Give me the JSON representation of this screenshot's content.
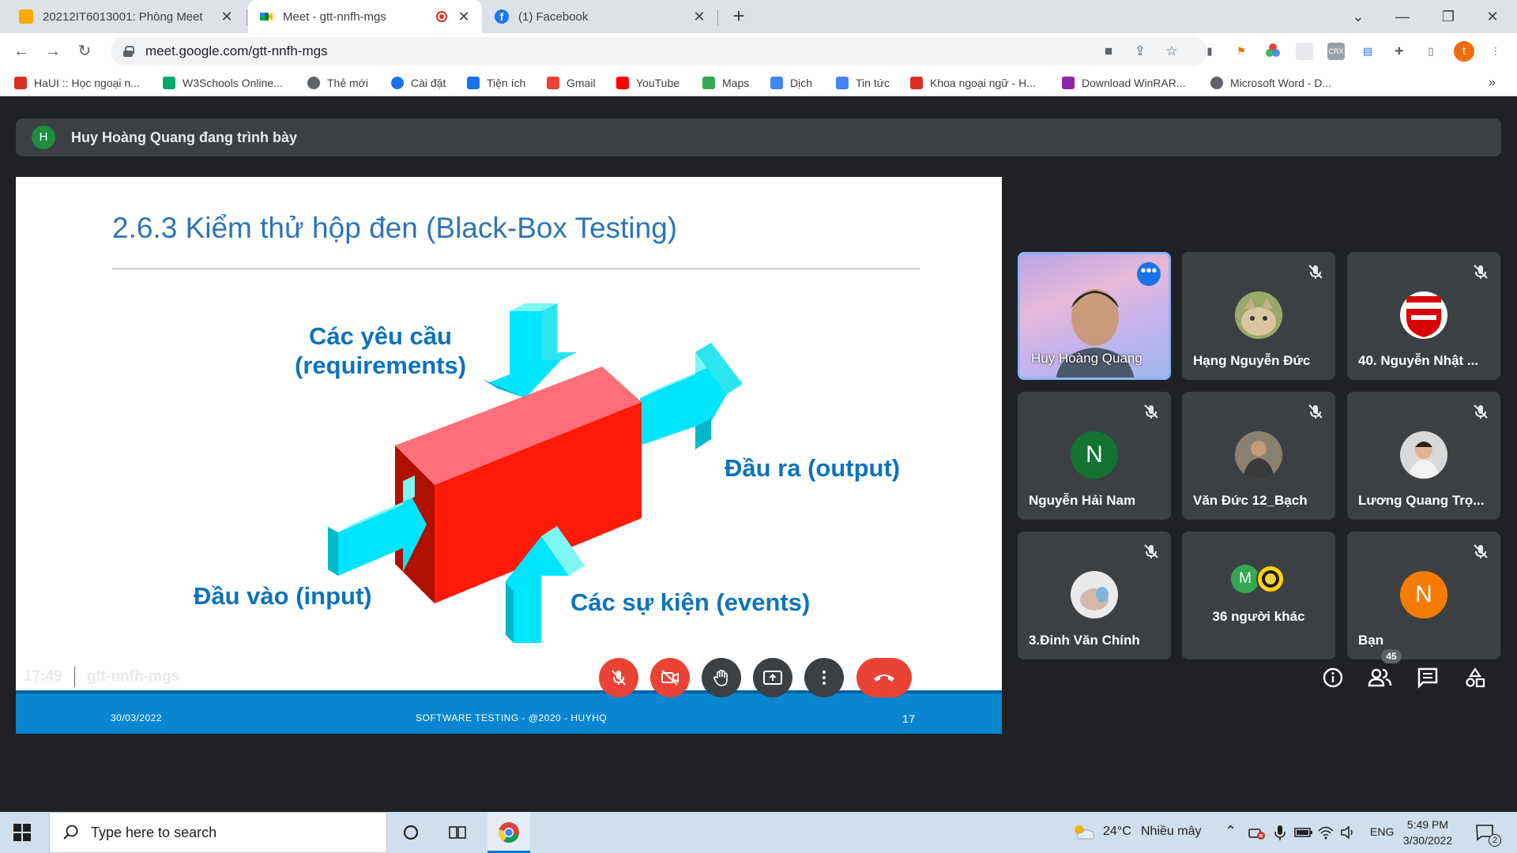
{
  "browser": {
    "tabs": [
      {
        "title": "20212IT6013001: Phòng Meet",
        "icon": "haui-favicon"
      },
      {
        "title": "Meet - gtt-nnfh-mgs",
        "icon": "meet-favicon"
      },
      {
        "title": "(1) Facebook",
        "icon": "facebook-favicon"
      }
    ],
    "new_tab_label": "+",
    "url": "meet.google.com/gtt-nnfh-mgs",
    "profile_initial": "t",
    "bookmarks": [
      {
        "label": "HaUI :: Học ngoại n...",
        "color": "#d93025"
      },
      {
        "label": "W3Schools Online...",
        "color": "#04aa6d"
      },
      {
        "label": "Thẻ mới",
        "color": "#5f6368"
      },
      {
        "label": "Cài đặt",
        "color": "#1a73e8"
      },
      {
        "label": "Tiện ích",
        "color": "#1a73e8"
      },
      {
        "label": "Gmail",
        "color": "#ea4335"
      },
      {
        "label": "YouTube",
        "color": "#ff0000"
      },
      {
        "label": "Maps",
        "color": "#34a853"
      },
      {
        "label": "Dịch",
        "color": "#4285f4"
      },
      {
        "label": "Tin tức",
        "color": "#4285f4"
      },
      {
        "label": "Khoa ngoại ngữ - H...",
        "color": "#d93025"
      },
      {
        "label": "Download WinRAR...",
        "color": "#8e24aa"
      },
      {
        "label": "Microsoft Word - D...",
        "color": "#5f6368"
      }
    ],
    "more_bookmarks": "»"
  },
  "meet": {
    "presenter_initial": "H",
    "presenter_text": "Huy Hoàng Quang đang trình bày",
    "slide": {
      "title": "2.6.3 Kiểm thử hộp đen (Black-Box Testing)",
      "label_requirements_1": "Các yêu cầu",
      "label_requirements_2": "(requirements)",
      "label_output": "Đầu ra (output)",
      "label_input": "Đầu vào (input)",
      "label_events": "Các sự kiện (events)",
      "footer_date": "30/03/2022",
      "footer_center": "SOFTWARE TESTING - @2020 - HUYHQ",
      "footer_page": "17"
    },
    "participants": [
      {
        "name": "Huy Hoàng Quang",
        "type": "video"
      },
      {
        "name": "Hạng Nguyễn Đức",
        "type": "photo"
      },
      {
        "name": "40. Nguyễn Nhật ...",
        "type": "photo"
      },
      {
        "name": "Nguyễn Hải Nam",
        "type": "letter",
        "letter": "N",
        "color": "#137333"
      },
      {
        "name": "Văn Đức 12_Bạch",
        "type": "photo"
      },
      {
        "name": "Lương Quang Trọ...",
        "type": "photo"
      },
      {
        "name": "3.Đinh Văn Chính",
        "type": "photo"
      },
      {
        "name": "36 người khác",
        "type": "group",
        "letter": "M",
        "color": "#34a853"
      },
      {
        "name": "Bạn",
        "type": "letter",
        "letter": "N",
        "color": "#f57c00"
      }
    ],
    "time": "17:49",
    "meeting_code": "gtt-nnfh-mgs",
    "people_count": "45"
  },
  "taskbar": {
    "search_placeholder": "Type here to search",
    "weather_temp": "24°C",
    "weather_desc": "Nhiều mây",
    "language": "ENG",
    "time": "5:49 PM",
    "date": "3/30/2022",
    "notification_count": "2"
  }
}
